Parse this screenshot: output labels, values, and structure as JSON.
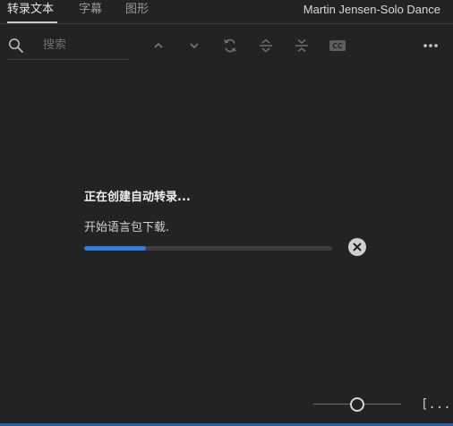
{
  "tabs": [
    {
      "label": "转录文本",
      "active": true
    },
    {
      "label": "字幕",
      "active": false
    },
    {
      "label": "图形",
      "active": false
    }
  ],
  "clip_title": "Martin Jensen-Solo Dance",
  "search": {
    "placeholder": "搜索",
    "value": ""
  },
  "toolbar_icons": [
    "chevron-up-icon",
    "chevron-down-icon",
    "refresh-icon",
    "expand-icon",
    "collapse-icon",
    "cc-icon",
    "more-icon"
  ],
  "status": {
    "title": "正在创建自动转录...",
    "subtitle": "开始语言包下载.",
    "progress": 0.25
  },
  "bottom": {
    "fit_label": "[...]",
    "zoom_level": 0.5
  },
  "colors": {
    "accent": "#2e7fdc",
    "background": "#232323"
  }
}
